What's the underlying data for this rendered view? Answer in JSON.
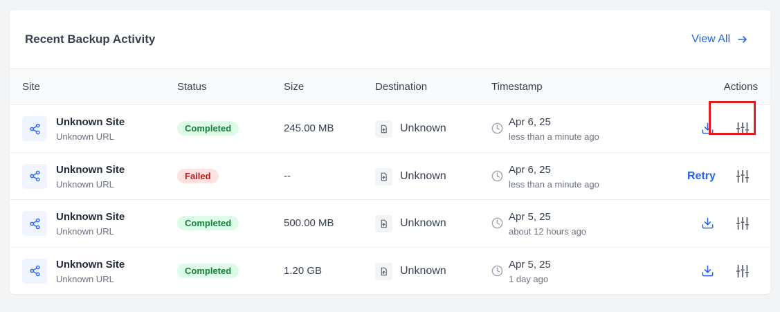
{
  "card": {
    "title": "Recent Backup Activity",
    "view_all_label": "View All"
  },
  "columns": {
    "site": "Site",
    "status": "Status",
    "size": "Size",
    "destination": "Destination",
    "timestamp": "Timestamp",
    "actions": "Actions"
  },
  "rows": [
    {
      "site": "Unknown Site",
      "url": "Unknown URL",
      "status": "Completed",
      "size": "245.00 MB",
      "destination": "Unknown",
      "date": "Apr 6, 25",
      "relative": "less than a minute ago",
      "action": "download"
    },
    {
      "site": "Unknown Site",
      "url": "Unknown URL",
      "status": "Failed",
      "size": "--",
      "destination": "Unknown",
      "date": "Apr 6, 25",
      "relative": "less than a minute ago",
      "action": "retry",
      "retry_label": "Retry"
    },
    {
      "site": "Unknown Site",
      "url": "Unknown URL",
      "status": "Completed",
      "size": "500.00 MB",
      "destination": "Unknown",
      "date": "Apr 5, 25",
      "relative": "about 12 hours ago",
      "action": "download"
    },
    {
      "site": "Unknown Site",
      "url": "Unknown URL",
      "status": "Completed",
      "size": "1.20 GB",
      "destination": "Unknown",
      "date": "Apr 5, 25",
      "relative": "1 day ago",
      "action": "download"
    }
  ],
  "colors": {
    "accent": "#2563eb",
    "completed_bg": "#dcfce7",
    "completed_text": "#15803d",
    "failed_bg": "#fee2e2",
    "failed_text": "#b91c1c",
    "highlight": "#e11d1d"
  },
  "icons": {
    "view_all": "arrow-right-icon",
    "site": "share-icon",
    "destination": "file-upload-icon",
    "timestamp": "clock-icon",
    "download": "download-icon",
    "settings": "sliders-icon"
  }
}
